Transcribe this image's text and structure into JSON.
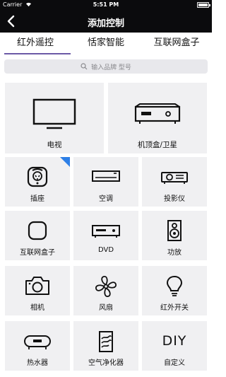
{
  "status": {
    "carrier": "Carrier",
    "time": "5:51 PM"
  },
  "nav": {
    "title": "添加控制"
  },
  "tabs": [
    {
      "label": "红外遥控",
      "active": true
    },
    {
      "label": "恬家智能",
      "active": false
    },
    {
      "label": "互联网盒子",
      "active": false
    }
  ],
  "search": {
    "placeholder": "输入品牌 型号"
  },
  "devices": {
    "tv": "电视",
    "stb": "机顶盒/卫星",
    "socket": "插座",
    "ac": "空调",
    "projector": "投影仪",
    "netbox": "互联网盒子",
    "dvd": "DVD",
    "amp": "功放",
    "camera": "相机",
    "fan": "风扇",
    "ir_switch": "红外开关",
    "heater": "热水器",
    "purifier": "空气净化器",
    "custom": "自定义",
    "diy_text": "DIY"
  },
  "colors": {
    "accent": "#6c5aa6",
    "badge": "#2d7fe6",
    "bar": "#0b0b0d",
    "tile": "#f0f0f2"
  }
}
